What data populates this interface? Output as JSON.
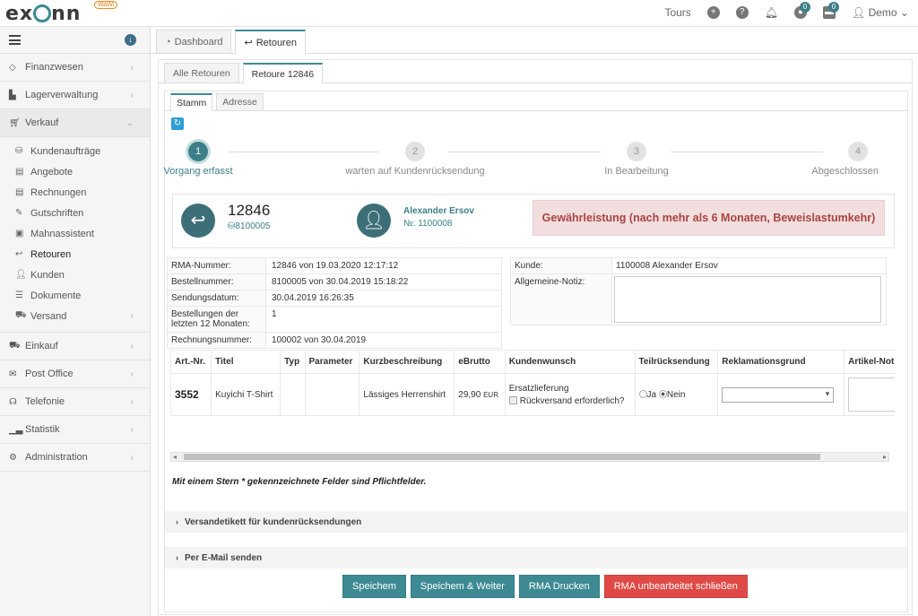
{
  "app": {
    "logo": "ex nn",
    "logo_badge": "WaWi"
  },
  "topbar": {
    "tours": "Tours",
    "badge1": "0",
    "badge2": "0",
    "user": "Demo"
  },
  "sidebar": {
    "items": [
      {
        "label": "Finanzwesen",
        "icon": "diamond-icon"
      },
      {
        "label": "Lagerverwaltung",
        "icon": "warehouse-icon"
      },
      {
        "label": "Verkauf",
        "icon": "cart-icon"
      }
    ],
    "verkauf_sub": [
      {
        "label": "Kundenaufträge"
      },
      {
        "label": "Angebote"
      },
      {
        "label": "Rechnungen"
      },
      {
        "label": "Gutschriften"
      },
      {
        "label": "Mahnassistent"
      },
      {
        "label": "Retouren"
      },
      {
        "label": "Kunden"
      },
      {
        "label": "Dokumente"
      },
      {
        "label": "Versand"
      }
    ],
    "items2": [
      {
        "label": "Einkauf"
      },
      {
        "label": "Post Office"
      },
      {
        "label": "Telefonie"
      },
      {
        "label": "Statistik"
      },
      {
        "label": "Administration"
      }
    ]
  },
  "tabs": {
    "dashboard": "Dashboard",
    "retouren": "Retouren",
    "alle": "Alle Retouren",
    "current": "Retoure 12846",
    "stamm": "Stamm",
    "adresse": "Adresse"
  },
  "steps": [
    {
      "n": "1",
      "label": "Vorgang erfasst"
    },
    {
      "n": "2",
      "label": "warten auf Kundenrücksendung"
    },
    {
      "n": "3",
      "label": "In Bearbeitung"
    },
    {
      "n": "4",
      "label": "Abgeschlossen"
    }
  ],
  "header": {
    "rma_no": "12846",
    "order_ref": "8100005",
    "customer_name": "Alexander Ersov",
    "customer_no": "№: 1100008",
    "alert": "Gewährleistung (nach mehr als 6 Monaten, Beweislastumkehr)"
  },
  "info": [
    {
      "k": "RMA-Nummer:",
      "v": "12846 von 19.03.2020 12:17:12"
    },
    {
      "k": "Bestellnummer:",
      "v": "8100005 von 30.04.2019 15:18:22"
    },
    {
      "k": "Sendungsdatum:",
      "v": "30.04.2019 16:26:35"
    },
    {
      "k": "Bestellungen der letzten 12 Monaten:",
      "v": "1"
    },
    {
      "k": "Rechnungsnummer:",
      "v": "100002 von 30.04.2019"
    }
  ],
  "info2": {
    "kunde_k": "Kunde:",
    "kunde_v": "1100008 Alexander Ersov",
    "notiz_k": "Allgemeine-Notiz:"
  },
  "table": {
    "headers": [
      "Art.-Nr.",
      "Titel",
      "Typ",
      "Parameter",
      "Kurzbeschreibung",
      "eBrutto",
      "Kundenwunsch",
      "Teilrücksendung",
      "Reklamationsgrund",
      "Artikel-Notiz"
    ],
    "row": {
      "artno": "3552",
      "titel": "Kuyichi T-Shirt",
      "typ": "",
      "parameter": "",
      "kurz": "Lässiges Herrenshirt",
      "price": "29,90",
      "currency": "EUR",
      "wunsch": "Ersatzlieferung",
      "rueck": "Rückversand erforderlich?",
      "ja": "Ja",
      "nein": "Nein"
    }
  },
  "pflicht": "Mit einem Stern * gekennzeichnete Felder sind Pflichtfelder.",
  "collapsibles": {
    "versand": "Versandetikett für kundenrücksendungen",
    "email": "Per E-Mail senden"
  },
  "buttons": {
    "save": "Speichem",
    "save_next": "Speichem & Weiter",
    "print": "RMA Drucken",
    "close": "RMA unbearbeitet schließen"
  },
  "colors": {
    "accent": "#3d8a93",
    "danger": "#e04a46",
    "alert_bg": "#f2dede"
  }
}
